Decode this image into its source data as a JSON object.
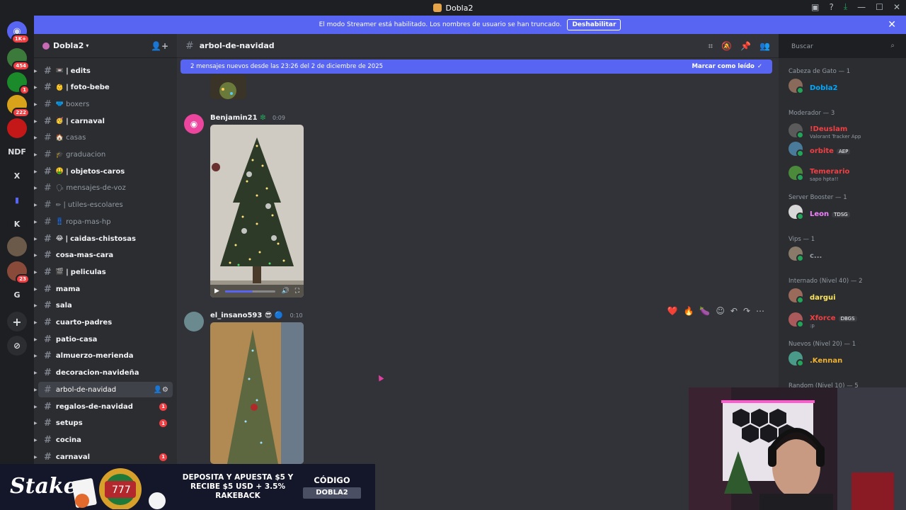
{
  "window": {
    "title": "Dobla2"
  },
  "guilds": [
    {
      "label": "1K+"
    },
    {
      "label": "454"
    },
    {
      "label": "1"
    },
    {
      "label": "222"
    },
    {
      "label": ""
    },
    {
      "label": "NDF"
    },
    {
      "label": "X"
    },
    {
      "label": ""
    },
    {
      "label": "K"
    },
    {
      "label": ""
    },
    {
      "label": "23"
    },
    {
      "label": "G"
    }
  ],
  "banner": {
    "text": "El modo Streamer está habilitado. Los nombres de usuario se han truncado.",
    "button": "Deshabilitar"
  },
  "server": {
    "name": "Dobla2"
  },
  "channels": [
    {
      "name": "edits",
      "emoji": "📼",
      "state": "unread",
      "divider": true,
      "badge": ""
    },
    {
      "name": "foto-bebe",
      "emoji": "👶",
      "state": "unread",
      "divider": true,
      "badge": ""
    },
    {
      "name": "boxers",
      "emoji": "🩲",
      "state": "muted",
      "divider": false,
      "badge": ""
    },
    {
      "name": "carnaval",
      "emoji": "🥳",
      "state": "unread",
      "divider": true,
      "badge": ""
    },
    {
      "name": "casas",
      "emoji": "🏠",
      "state": "muted",
      "divider": false,
      "badge": ""
    },
    {
      "name": "graduacion",
      "emoji": "🎓",
      "state": "muted",
      "divider": false,
      "badge": ""
    },
    {
      "name": "objetos-caros",
      "emoji": "🤑",
      "state": "unread",
      "divider": true,
      "badge": ""
    },
    {
      "name": "mensajes-de-voz",
      "emoji": "🗣",
      "state": "muted",
      "divider": false,
      "badge": ""
    },
    {
      "name": "utiles-escolares",
      "emoji": "✏",
      "state": "muted",
      "divider": true,
      "badge": ""
    },
    {
      "name": "ropa-mas-hp",
      "emoji": "👖",
      "state": "muted",
      "divider": false,
      "badge": ""
    },
    {
      "name": "caidas-chistosas",
      "emoji": "😂",
      "state": "unread",
      "divider": true,
      "badge": ""
    },
    {
      "name": "cosa-mas-cara",
      "emoji": "",
      "state": "unread",
      "divider": false,
      "badge": ""
    },
    {
      "name": "peliculas",
      "emoji": "🎬",
      "state": "unread",
      "divider": true,
      "badge": ""
    },
    {
      "name": "mama",
      "emoji": "",
      "state": "unread",
      "divider": false,
      "badge": ""
    },
    {
      "name": "sala",
      "emoji": "",
      "state": "unread",
      "divider": false,
      "badge": ""
    },
    {
      "name": "cuarto-padres",
      "emoji": "",
      "state": "unread",
      "divider": false,
      "badge": ""
    },
    {
      "name": "patio-casa",
      "emoji": "",
      "state": "unread",
      "divider": false,
      "badge": ""
    },
    {
      "name": "almuerzo-merienda",
      "emoji": "",
      "state": "unread",
      "divider": false,
      "badge": ""
    },
    {
      "name": "decoracion-navideña",
      "emoji": "",
      "state": "unread",
      "divider": false,
      "badge": ""
    },
    {
      "name": "arbol-de-navidad",
      "emoji": "",
      "state": "active",
      "divider": false,
      "badge": ""
    },
    {
      "name": "regalos-de-navidad",
      "emoji": "",
      "state": "unread",
      "divider": false,
      "badge": "1"
    },
    {
      "name": "setups",
      "emoji": "",
      "state": "unread",
      "divider": false,
      "badge": "1"
    },
    {
      "name": "cocina",
      "emoji": "",
      "state": "unread",
      "divider": false,
      "badge": ""
    },
    {
      "name": "carnaval",
      "emoji": "",
      "state": "unread",
      "divider": false,
      "badge": "1"
    }
  ],
  "channel_header": {
    "name": "arbol-de-navidad"
  },
  "search": {
    "placeholder": "Buscar"
  },
  "new_messages": {
    "text": "2 mensajes nuevos desde las 23:26 del 2 de diciembre de 2025",
    "action": "Marcar como leído"
  },
  "messages": [
    {
      "author": "Benjamin21",
      "time": "0:09",
      "badges": "❇",
      "color": "#f2f3f5"
    },
    {
      "author": "el_insano593",
      "time": "0:10",
      "badges": "😎 🔵",
      "color": "#f2f3f5"
    }
  ],
  "video": {
    "progress": 0.55
  },
  "reactions": [
    "❤️",
    "🔥",
    "🍆"
  ],
  "members": {
    "groups": [
      {
        "title": "Cabeza de Gato — 1",
        "members": [
          {
            "name": "Dobla2",
            "color": "#00a8fc",
            "sub": "",
            "tag": ""
          }
        ]
      },
      {
        "title": "Moderador — 3",
        "members": [
          {
            "name": "!Deuslam",
            "color": "#f23f43",
            "sub": "Valorant Tracker App",
            "tag": ""
          },
          {
            "name": "orbite",
            "color": "#f23f43",
            "sub": "",
            "tag": "AEP"
          },
          {
            "name": "Temerario",
            "color": "#f23f43",
            "sub": "sapo hpta!!",
            "tag": ""
          }
        ]
      },
      {
        "title": "Server Booster — 1",
        "members": [
          {
            "name": "Leon",
            "color": "#f47fff",
            "sub": "",
            "tag": "TDSG"
          }
        ]
      },
      {
        "title": "Vips — 1",
        "members": [
          {
            "name": "c...",
            "color": "#949ba4",
            "sub": "",
            "tag": ""
          }
        ]
      },
      {
        "title": "Internado (Nivel 40) — 2",
        "members": [
          {
            "name": "dargui",
            "color": "#fee75c",
            "sub": "",
            "tag": ""
          },
          {
            "name": "Xforce",
            "color": "#f23f43",
            "sub": ":p",
            "tag": "DBGS"
          }
        ]
      },
      {
        "title": "Nuevos (Nivel 20) — 1",
        "members": [
          {
            "name": ".Kennan",
            "color": "#f0b232",
            "sub": "",
            "tag": ""
          }
        ]
      },
      {
        "title": "Random (Nivel 10) — 5",
        "members": []
      }
    ]
  },
  "promo": {
    "brand": "Stake",
    "offer_line1": "DEPOSITA Y APUESTA $5 Y",
    "offer_line2": "RECIBE $5 USD + 3.5%",
    "offer_line3": "RAKEBACK",
    "code_label": "CÓDIGO",
    "code": "DOBLA2"
  }
}
